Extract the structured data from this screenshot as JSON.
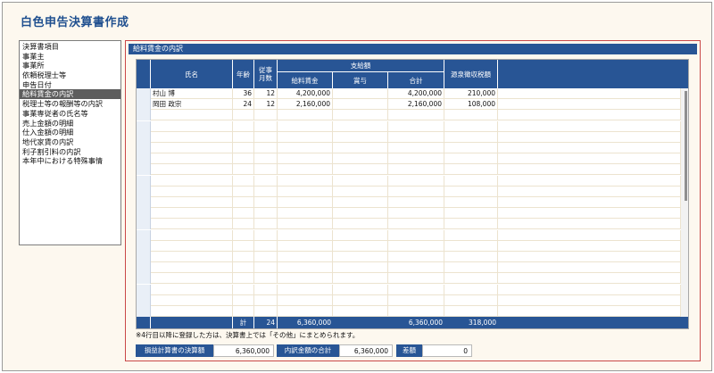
{
  "app": {
    "title": "白色申告決算書作成"
  },
  "nav": {
    "items": [
      {
        "label": "決算書項目",
        "selected": false
      },
      {
        "label": "事業主",
        "selected": false
      },
      {
        "label": "事業所",
        "selected": false
      },
      {
        "label": "依頼税理士等",
        "selected": false
      },
      {
        "label": "申告日付",
        "selected": false
      },
      {
        "label": "給料賃金の内訳",
        "selected": true
      },
      {
        "label": "税理士等の報酬等の内訳",
        "selected": false
      },
      {
        "label": "事業専従者の氏名等",
        "selected": false
      },
      {
        "label": "売上金額の明細",
        "selected": false
      },
      {
        "label": "仕入金額の明細",
        "selected": false
      },
      {
        "label": "地代家賃の内訳",
        "selected": false
      },
      {
        "label": "利子割引料の内訳",
        "selected": false
      },
      {
        "label": "本年中における特殊事情",
        "selected": false
      }
    ]
  },
  "panel": {
    "title": "給料賃金の内訳",
    "columns": {
      "name": "氏名",
      "age": "年齢",
      "months": "従事\n月数",
      "payment_group": "支給額",
      "salary": "給料賃金",
      "bonus": "賞与",
      "total": "合計",
      "withholding": "源泉徴収税額"
    },
    "rows": [
      {
        "name": "村山 博",
        "age": "36",
        "months": "12",
        "salary": "4,200,000",
        "bonus": "",
        "total": "4,200,000",
        "withholding": "210,000"
      },
      {
        "name": "岡田 政宗",
        "age": "24",
        "months": "12",
        "salary": "2,160,000",
        "bonus": "",
        "total": "2,160,000",
        "withholding": "108,000"
      }
    ],
    "footer": {
      "label": "計",
      "months": "24",
      "salary": "6,360,000",
      "bonus": "",
      "total": "6,360,000",
      "withholding": "318,000"
    },
    "note": "※4行目以降に登録した方は、決算書上では「その他」にまとめられます。"
  },
  "summary": {
    "pl_label": "損益計算書の決算額",
    "pl_value": "6,360,000",
    "breakdown_label": "内訳金額の合計",
    "breakdown_value": "6,360,000",
    "diff_label": "差額",
    "diff_value": "0"
  },
  "colors": {
    "header_blue": "#285595",
    "title_blue": "#1f4f8f",
    "panel_border": "#c94848",
    "background": "#fdf8ef",
    "selected_item": "#5d5d5d"
  }
}
